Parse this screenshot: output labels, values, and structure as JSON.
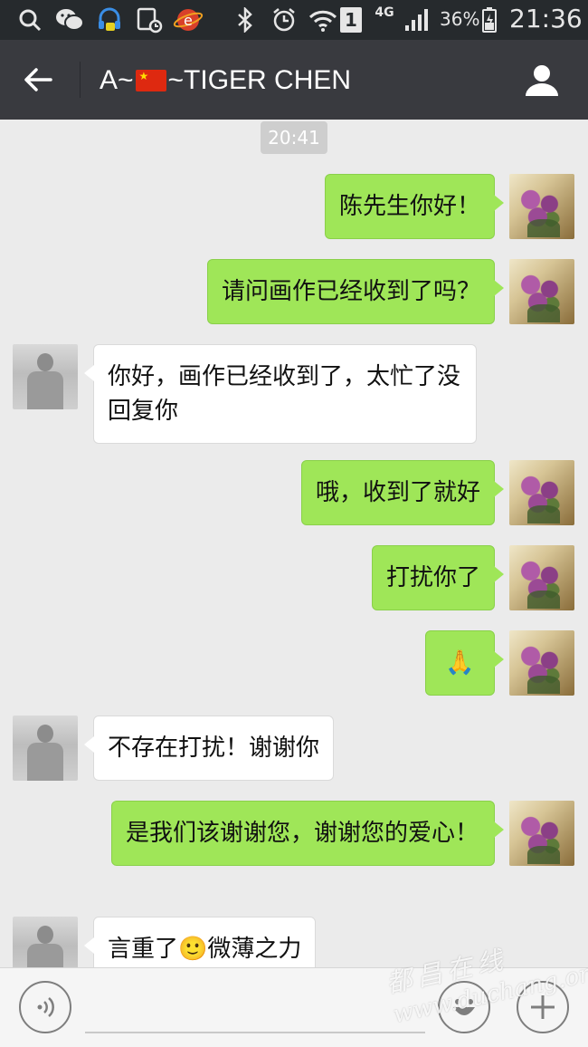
{
  "status_bar": {
    "battery": "36%",
    "time": "21:36",
    "network": "4G",
    "sim": "1",
    "icons": [
      "search-icon",
      "wechat-icon",
      "headset-icon",
      "sim-manager-icon",
      "browser-icon",
      "bluetooth-icon",
      "alarm-icon",
      "wifi-icon",
      "signal-icon",
      "battery-icon"
    ]
  },
  "header": {
    "title_prefix": "A~",
    "title_suffix": "~TIGER CHEN"
  },
  "chat": {
    "timestamp": "20:41",
    "messages": [
      {
        "side": "me",
        "text": "陈先生你好！"
      },
      {
        "side": "me",
        "text": "请问画作已经收到了吗？"
      },
      {
        "side": "other",
        "text": "你好，画作已经收到了，太忙了没回复你"
      },
      {
        "side": "me",
        "text": "哦，收到了就好"
      },
      {
        "side": "me",
        "text": "打扰你了"
      },
      {
        "side": "me",
        "text": "🙏"
      },
      {
        "side": "other",
        "text": "不存在打扰！谢谢你"
      },
      {
        "side": "me",
        "text": "是我们该谢谢您，谢谢您的爱心！"
      },
      {
        "side": "other",
        "text_before": "言重了",
        "emoji": "🙂",
        "text_after": "微薄之力"
      }
    ]
  },
  "watermark": {
    "chinese": "都昌在线",
    "url": "www.duchang.org"
  },
  "colors": {
    "status_bar": "#262a2d",
    "title_bar": "#393a3f",
    "chat_bg": "#ebebeb",
    "my_bubble": "#9fe658",
    "other_bubble": "#ffffff"
  }
}
